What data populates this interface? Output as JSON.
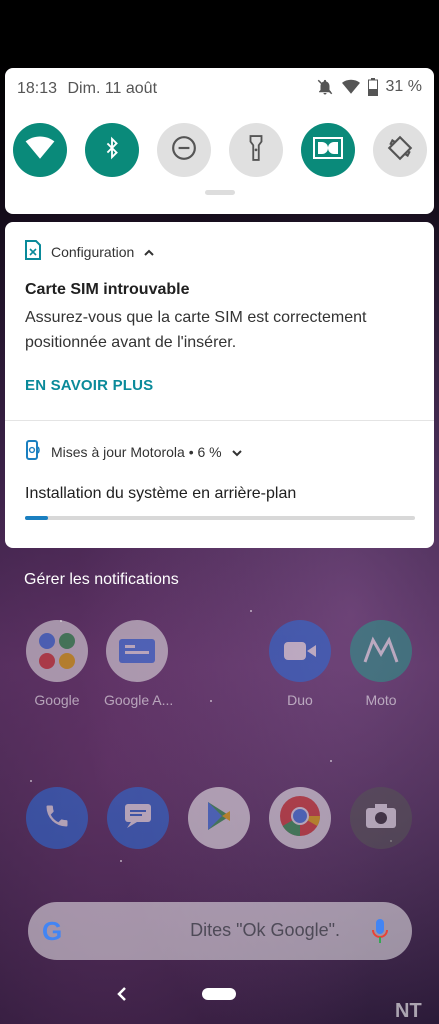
{
  "status_bar": {
    "time": "18:13",
    "date": "Dim. 11 août",
    "battery": "31 %"
  },
  "quick_settings": {
    "tiles": [
      {
        "name": "wifi",
        "state": "on"
      },
      {
        "name": "bluetooth",
        "state": "on"
      },
      {
        "name": "do-not-disturb",
        "state": "off"
      },
      {
        "name": "flashlight",
        "state": "off"
      },
      {
        "name": "dolby",
        "state": "on"
      },
      {
        "name": "auto-rotate",
        "state": "off"
      }
    ]
  },
  "notifications": {
    "sim": {
      "app": "Configuration",
      "title": "Carte SIM introuvable",
      "body": "Assurez-vous que la carte SIM est correctement positionnée avant de l'insérer.",
      "action": "EN SAVOIR PLUS"
    },
    "update": {
      "app": "Mises à jour Motorola • 6 %",
      "title": "Installation du système en arrière-plan",
      "progress": 0.06
    },
    "manage": "Gérer les notifications"
  },
  "home": {
    "apps": [
      {
        "label": "Google"
      },
      {
        "label": "Google A..."
      },
      {
        "label": "Duo"
      },
      {
        "label": "Moto"
      }
    ],
    "search_hint": "Dites \"Ok Google\".",
    "search_logo": "G"
  },
  "watermark": "NT",
  "colors": {
    "accent": "#0a8a7a",
    "action": "#0a8a9a",
    "progress": "#1a7fc0"
  }
}
